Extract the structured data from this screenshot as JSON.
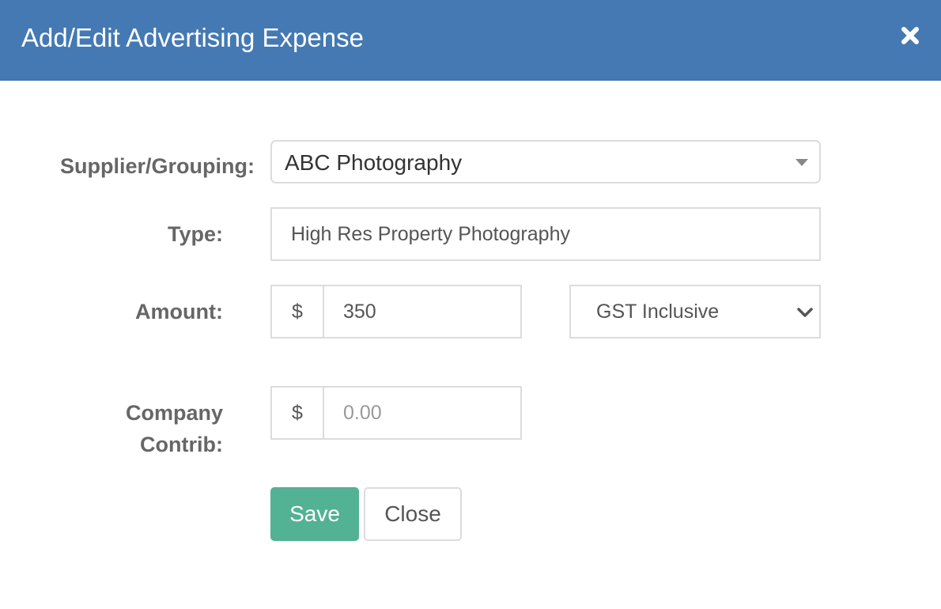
{
  "header": {
    "title": "Add/Edit Advertising Expense",
    "close_icon": "close-icon"
  },
  "form": {
    "supplier": {
      "label": "Supplier/Grouping:",
      "selected": "ABC Photography"
    },
    "type": {
      "label": "Type:",
      "value": "High Res Property Photography"
    },
    "amount": {
      "label": "Amount:",
      "currency": "$",
      "value": "350",
      "tax_selected": "GST Inclusive"
    },
    "company_contrib": {
      "label_line1": "Company",
      "label_line2": "Contrib:",
      "currency": "$",
      "placeholder": "0.00"
    }
  },
  "buttons": {
    "save_label": "Save",
    "close_label": "Close"
  },
  "colors": {
    "header_bg": "#4479b3",
    "save_bg": "#52b293",
    "label_text": "#666666",
    "border": "#dcdcdc"
  }
}
